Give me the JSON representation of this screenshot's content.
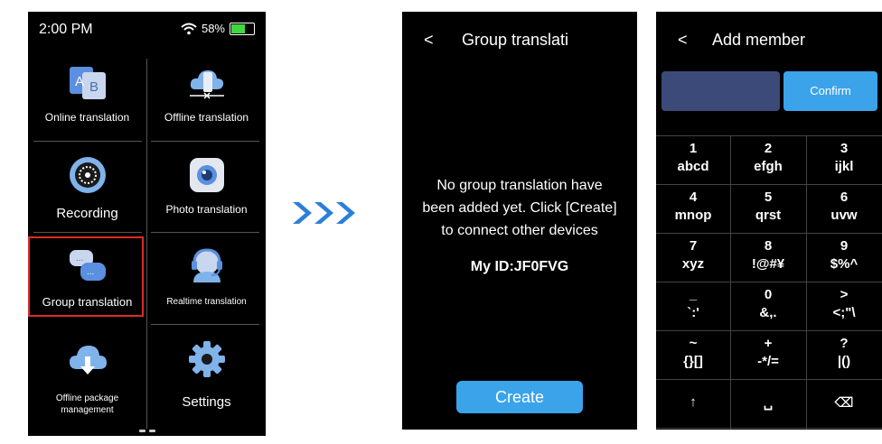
{
  "screen1": {
    "status": {
      "time": "2:00 PM",
      "battery": "58%"
    },
    "apps": [
      {
        "label": "Online translation",
        "icon": "online-translation-icon"
      },
      {
        "label": "Offline translation",
        "icon": "offline-translation-icon"
      },
      {
        "label": "Recording",
        "icon": "recording-icon"
      },
      {
        "label": "Photo translation",
        "icon": "photo-translation-icon"
      },
      {
        "label": "Group translation",
        "icon": "group-translation-icon",
        "highlighted": true
      },
      {
        "label": "Realtime translation",
        "icon": "realtime-translation-icon"
      },
      {
        "label": "Offline package management",
        "icon": "cloud-download-icon"
      },
      {
        "label": "Settings",
        "icon": "gear-icon"
      }
    ]
  },
  "screen2": {
    "title": "Group translati",
    "message": [
      "No group translation have",
      "been added yet. Click [Create]",
      "to connect other devices"
    ],
    "my_id": "My ID:JF0FVG",
    "create_label": "Create"
  },
  "screen3": {
    "title": "Add member",
    "confirm_label": "Confirm",
    "keys": [
      [
        "1",
        "abcd"
      ],
      [
        "2",
        "efgh"
      ],
      [
        "3",
        "ijkl"
      ],
      [
        "4",
        "mnop"
      ],
      [
        "5",
        "qrst"
      ],
      [
        "6",
        "uvw"
      ],
      [
        "7",
        "xyz"
      ],
      [
        "8",
        "!@#¥"
      ],
      [
        "9",
        "$%^"
      ],
      [
        "_",
        "`:'"
      ],
      [
        "0",
        "&,."
      ],
      [
        ">",
        "<;\"\\"
      ],
      [
        "~",
        "{}[]"
      ],
      [
        "+",
        "-*/="
      ],
      [
        "?",
        "|()"
      ],
      [
        "↑",
        ""
      ],
      [
        "␣",
        ""
      ],
      [
        "⌫",
        ""
      ]
    ]
  },
  "colors": {
    "accent": "#3aa3ea",
    "highlight": "#e02a2a",
    "arrow": "#2b7fd9",
    "input": "#3b4a78"
  }
}
